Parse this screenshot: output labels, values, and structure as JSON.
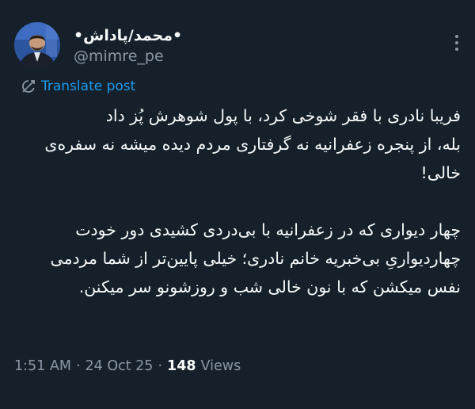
{
  "author": {
    "display_name": "•محمد/پاداش•",
    "handle": "@mimre_pe"
  },
  "translate": {
    "label": "Translate post",
    "icon": "translate-icon"
  },
  "post": {
    "text": "فریبا نادری با فقر شوخی کرد، با پول شوهرش پُز داد\nبله، از پنجره زعفرانیه نه گرفتاری مردم دیده میشه نه سفره‌ی خالی!\n\nچهار دیواری که در زعفرانیه با بی‌دردی کشیدی دور خودت چهاردیواریِ بی‌خبریه خانم نادری؛ خیلی پایین‌تر از شما مردمی نفس میکشن که با نون خالی شب و روزشونو سر میکنن."
  },
  "meta": {
    "time": "1:51 AM",
    "date": "24 Oct 25",
    "separator": "·",
    "views_count": "148",
    "views_label": "Views"
  },
  "colors": {
    "background": "#15202b",
    "text": "#f7f9f9",
    "secondary_text": "#8b98a5",
    "accent": "#1d9bf0"
  },
  "icons": {
    "more": "more-dots-icon",
    "translate": "translate-icon"
  }
}
